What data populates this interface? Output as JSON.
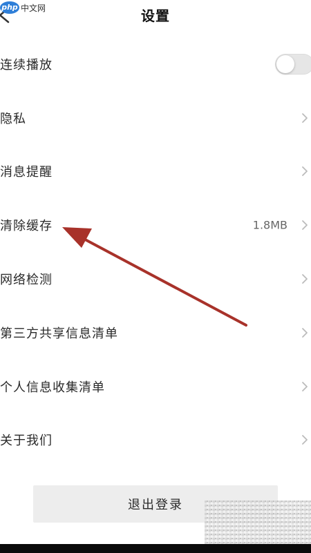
{
  "header": {
    "title": "设置",
    "watermark_badge": "php",
    "watermark_text": "中文网"
  },
  "settings": {
    "items": [
      {
        "label": "连续播放",
        "control": "toggle",
        "toggle_on": false
      },
      {
        "label": "隐私",
        "control": "chevron"
      },
      {
        "label": "消息提醒",
        "control": "chevron"
      },
      {
        "label": "清除缓存",
        "control": "chevron",
        "value": "1.8MB"
      },
      {
        "label": "网络检测",
        "control": "chevron"
      },
      {
        "label": "第三方共享信息清单",
        "control": "chevron"
      },
      {
        "label": "个人信息收集清单",
        "control": "chevron"
      },
      {
        "label": "关于我们",
        "control": "chevron"
      }
    ]
  },
  "logout": {
    "label": "退出登录"
  },
  "icons": {
    "back": "back-arrow-icon",
    "chevron": "chevron-right-icon",
    "annotation": "red-arrow-annotation"
  },
  "colors": {
    "annotation_arrow": "#a8322a",
    "toggle_off_track": "#e6e6e6",
    "chevron": "#bbbbbb",
    "logout_bg": "#ededed"
  }
}
